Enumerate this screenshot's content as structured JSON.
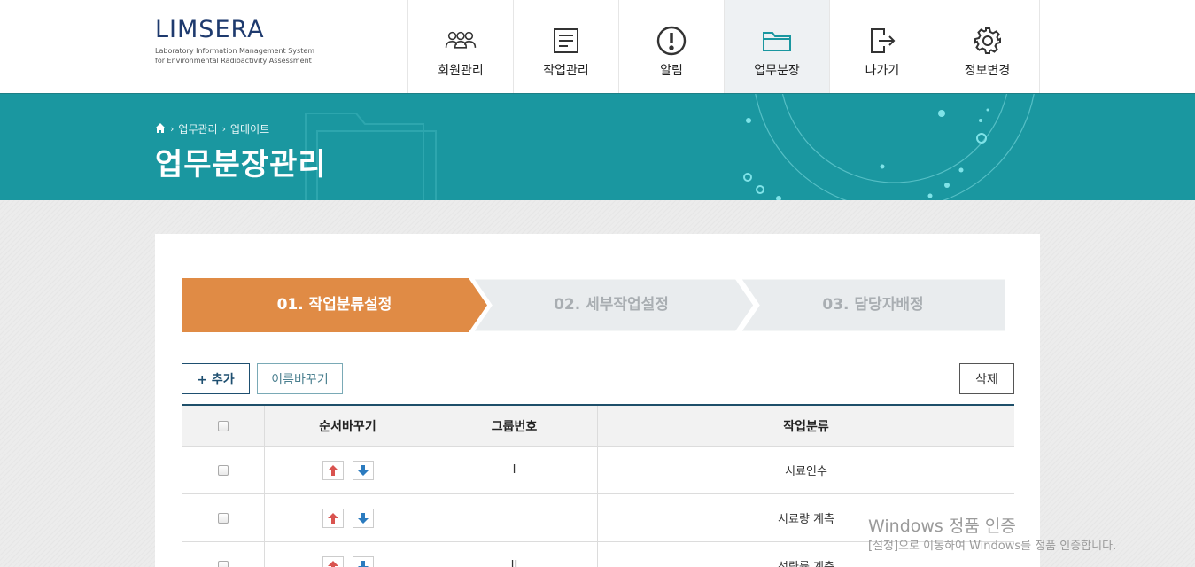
{
  "header": {
    "logo_title": "LIMSERA",
    "logo_sub_line1": "Laboratory Information Management System",
    "logo_sub_line2": "for Environmental Radioactivity Assessment",
    "nav": [
      {
        "label": "회원관리",
        "icon": "users-icon"
      },
      {
        "label": "작업관리",
        "icon": "document-icon"
      },
      {
        "label": "알림",
        "icon": "alert-icon"
      },
      {
        "label": "업무분장",
        "icon": "folder-icon",
        "active": true
      },
      {
        "label": "나가기",
        "icon": "logout-icon"
      },
      {
        "label": "정보변경",
        "icon": "gear-icon"
      }
    ]
  },
  "banner": {
    "breadcrumb": [
      "업무관리",
      "업데이트"
    ],
    "title": "업무분장관리"
  },
  "steps": [
    {
      "label": "01. 작업분류설정",
      "active": true
    },
    {
      "label": "02. 세부작업설정",
      "active": false
    },
    {
      "label": "03. 담당자배정",
      "active": false
    }
  ],
  "toolbar": {
    "add_label": "+ 추가",
    "rename_label": "이름바꾸기",
    "delete_label": "삭제"
  },
  "table": {
    "columns": [
      "",
      "순서바꾸기",
      "그룹번호",
      "작업분류"
    ],
    "rows": [
      {
        "group": "I",
        "category": "시료인수"
      },
      {
        "group": "",
        "category": "시료량 계측"
      },
      {
        "group": "II",
        "category": "선량률 계측"
      }
    ]
  },
  "watermark": {
    "line1": "Windows 정품 인증",
    "line2": "[설정]으로 이동하여 Windows를 정품 인증합니다."
  },
  "colors": {
    "teal": "#1a97a0",
    "navy": "#1e3a6e",
    "step_active": "#e08b45",
    "step_inactive": "#e9ecee",
    "arrow_up": "#d9534f",
    "arrow_down": "#2b7bbf"
  }
}
